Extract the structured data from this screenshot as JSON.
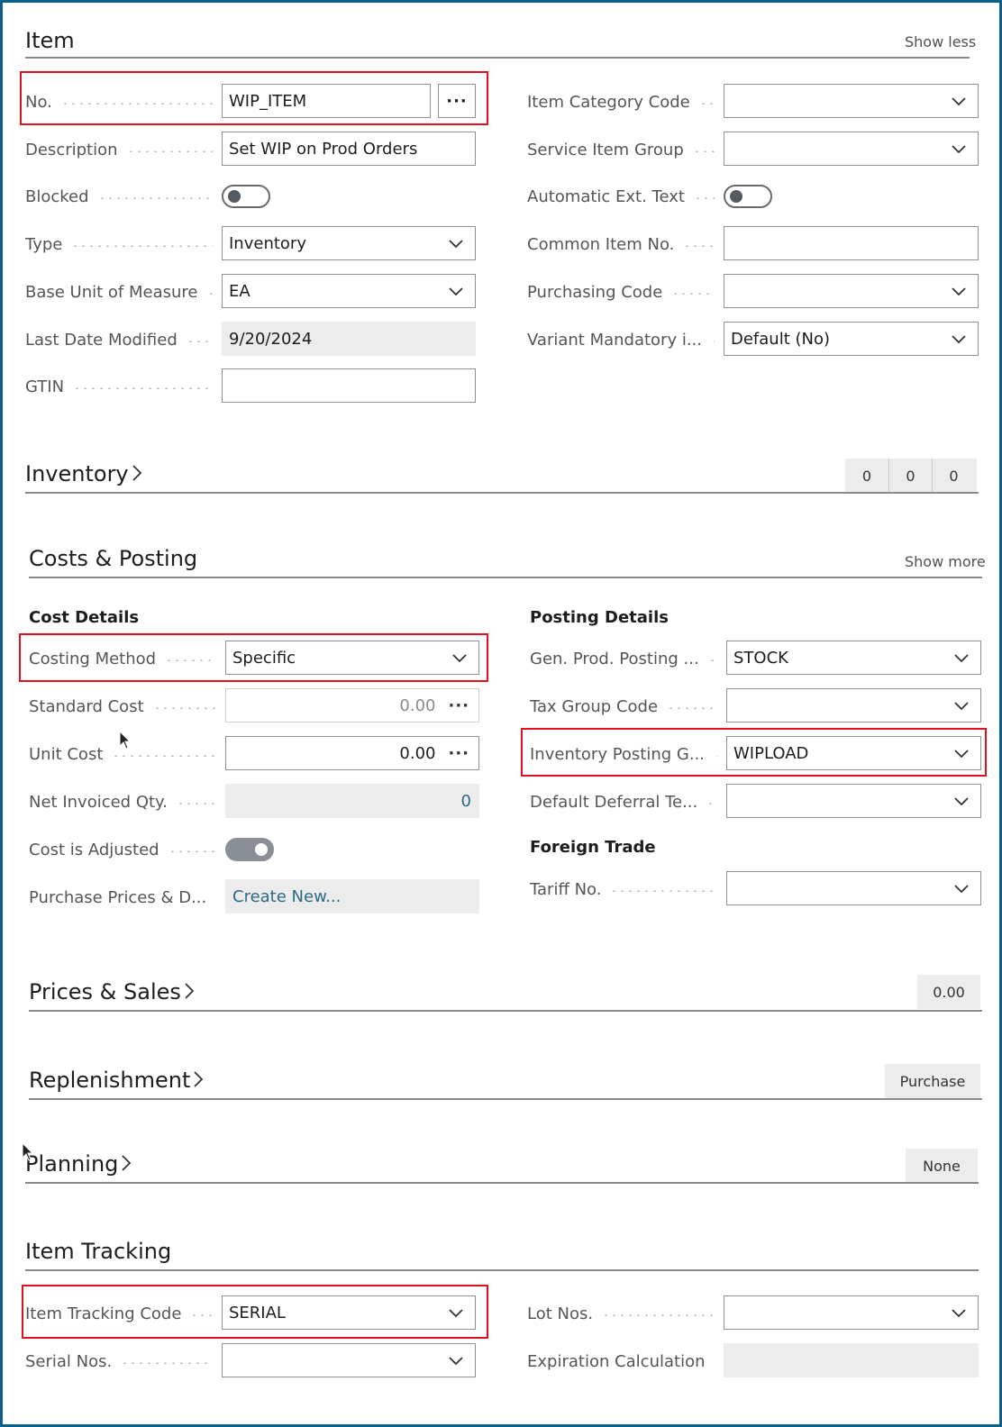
{
  "item": {
    "title": "Item",
    "show_less": "Show less",
    "fields": {
      "no_label": "No.",
      "no_value": "WIP_ITEM",
      "lookup_label": "···",
      "description_label": "Description",
      "description_value": "Set WIP on Prod Orders",
      "blocked_label": "Blocked",
      "type_label": "Type",
      "type_value": "Inventory",
      "base_uom_label": "Base Unit of Measure",
      "base_uom_value": "EA",
      "last_modified_label": "Last Date Modified",
      "last_modified_value": "9/20/2024",
      "gtin_label": "GTIN",
      "gtin_value": "",
      "item_category_label": "Item Category Code",
      "item_category_value": "",
      "service_group_label": "Service Item Group",
      "service_group_value": "",
      "auto_ext_text_label": "Automatic Ext. Text",
      "common_item_label": "Common Item No.",
      "common_item_value": "",
      "purchasing_code_label": "Purchasing Code",
      "purchasing_code_value": "",
      "variant_mandatory_label": "Variant Mandatory i...",
      "variant_mandatory_value": "Default (No)"
    },
    "blocked_on": false,
    "auto_ext_text_on": false
  },
  "inventory": {
    "title": "Inventory",
    "cues": [
      "0",
      "0",
      "0"
    ]
  },
  "costs": {
    "title": "Costs & Posting",
    "show_more": "Show more",
    "cost_details": "Cost Details",
    "posting_details": "Posting Details",
    "foreign_trade": "Foreign Trade",
    "costing_method_label": "Costing Method",
    "costing_method_value": "Specific",
    "standard_cost_label": "Standard Cost",
    "standard_cost_value": "0.00",
    "unit_cost_label": "Unit Cost",
    "unit_cost_value": "0.00",
    "net_invoiced_label": "Net Invoiced Qty.",
    "net_invoiced_value": "0",
    "cost_adjusted_label": "Cost is Adjusted",
    "cost_adjusted_on": true,
    "purchase_prices_label": "Purchase Prices & D...",
    "purchase_prices_value": "Create New...",
    "gen_prod_label": "Gen. Prod. Posting ...",
    "gen_prod_value": "STOCK",
    "tax_group_label": "Tax Group Code",
    "tax_group_value": "",
    "inv_posting_label": "Inventory Posting G...",
    "inv_posting_value": "WIPLOAD",
    "deferral_label": "Default Deferral Te...",
    "deferral_value": "",
    "tariff_label": "Tariff No.",
    "tariff_value": ""
  },
  "prices_sales": {
    "title": "Prices & Sales",
    "cue": "0.00"
  },
  "replenishment": {
    "title": "Replenishment",
    "cue": "Purchase"
  },
  "planning": {
    "title": "Planning",
    "cue": "None"
  },
  "tracking": {
    "title": "Item Tracking",
    "tracking_code_label": "Item Tracking Code",
    "tracking_code_value": "SERIAL",
    "serial_nos_label": "Serial Nos.",
    "serial_nos_value": "",
    "lot_nos_label": "Lot Nos.",
    "lot_nos_value": "",
    "expiration_label": "Expiration Calculation",
    "expiration_value": ""
  },
  "colors": {
    "frame": "#0b5f8a",
    "highlight": "#e0101e",
    "link": "#2c6a87"
  }
}
